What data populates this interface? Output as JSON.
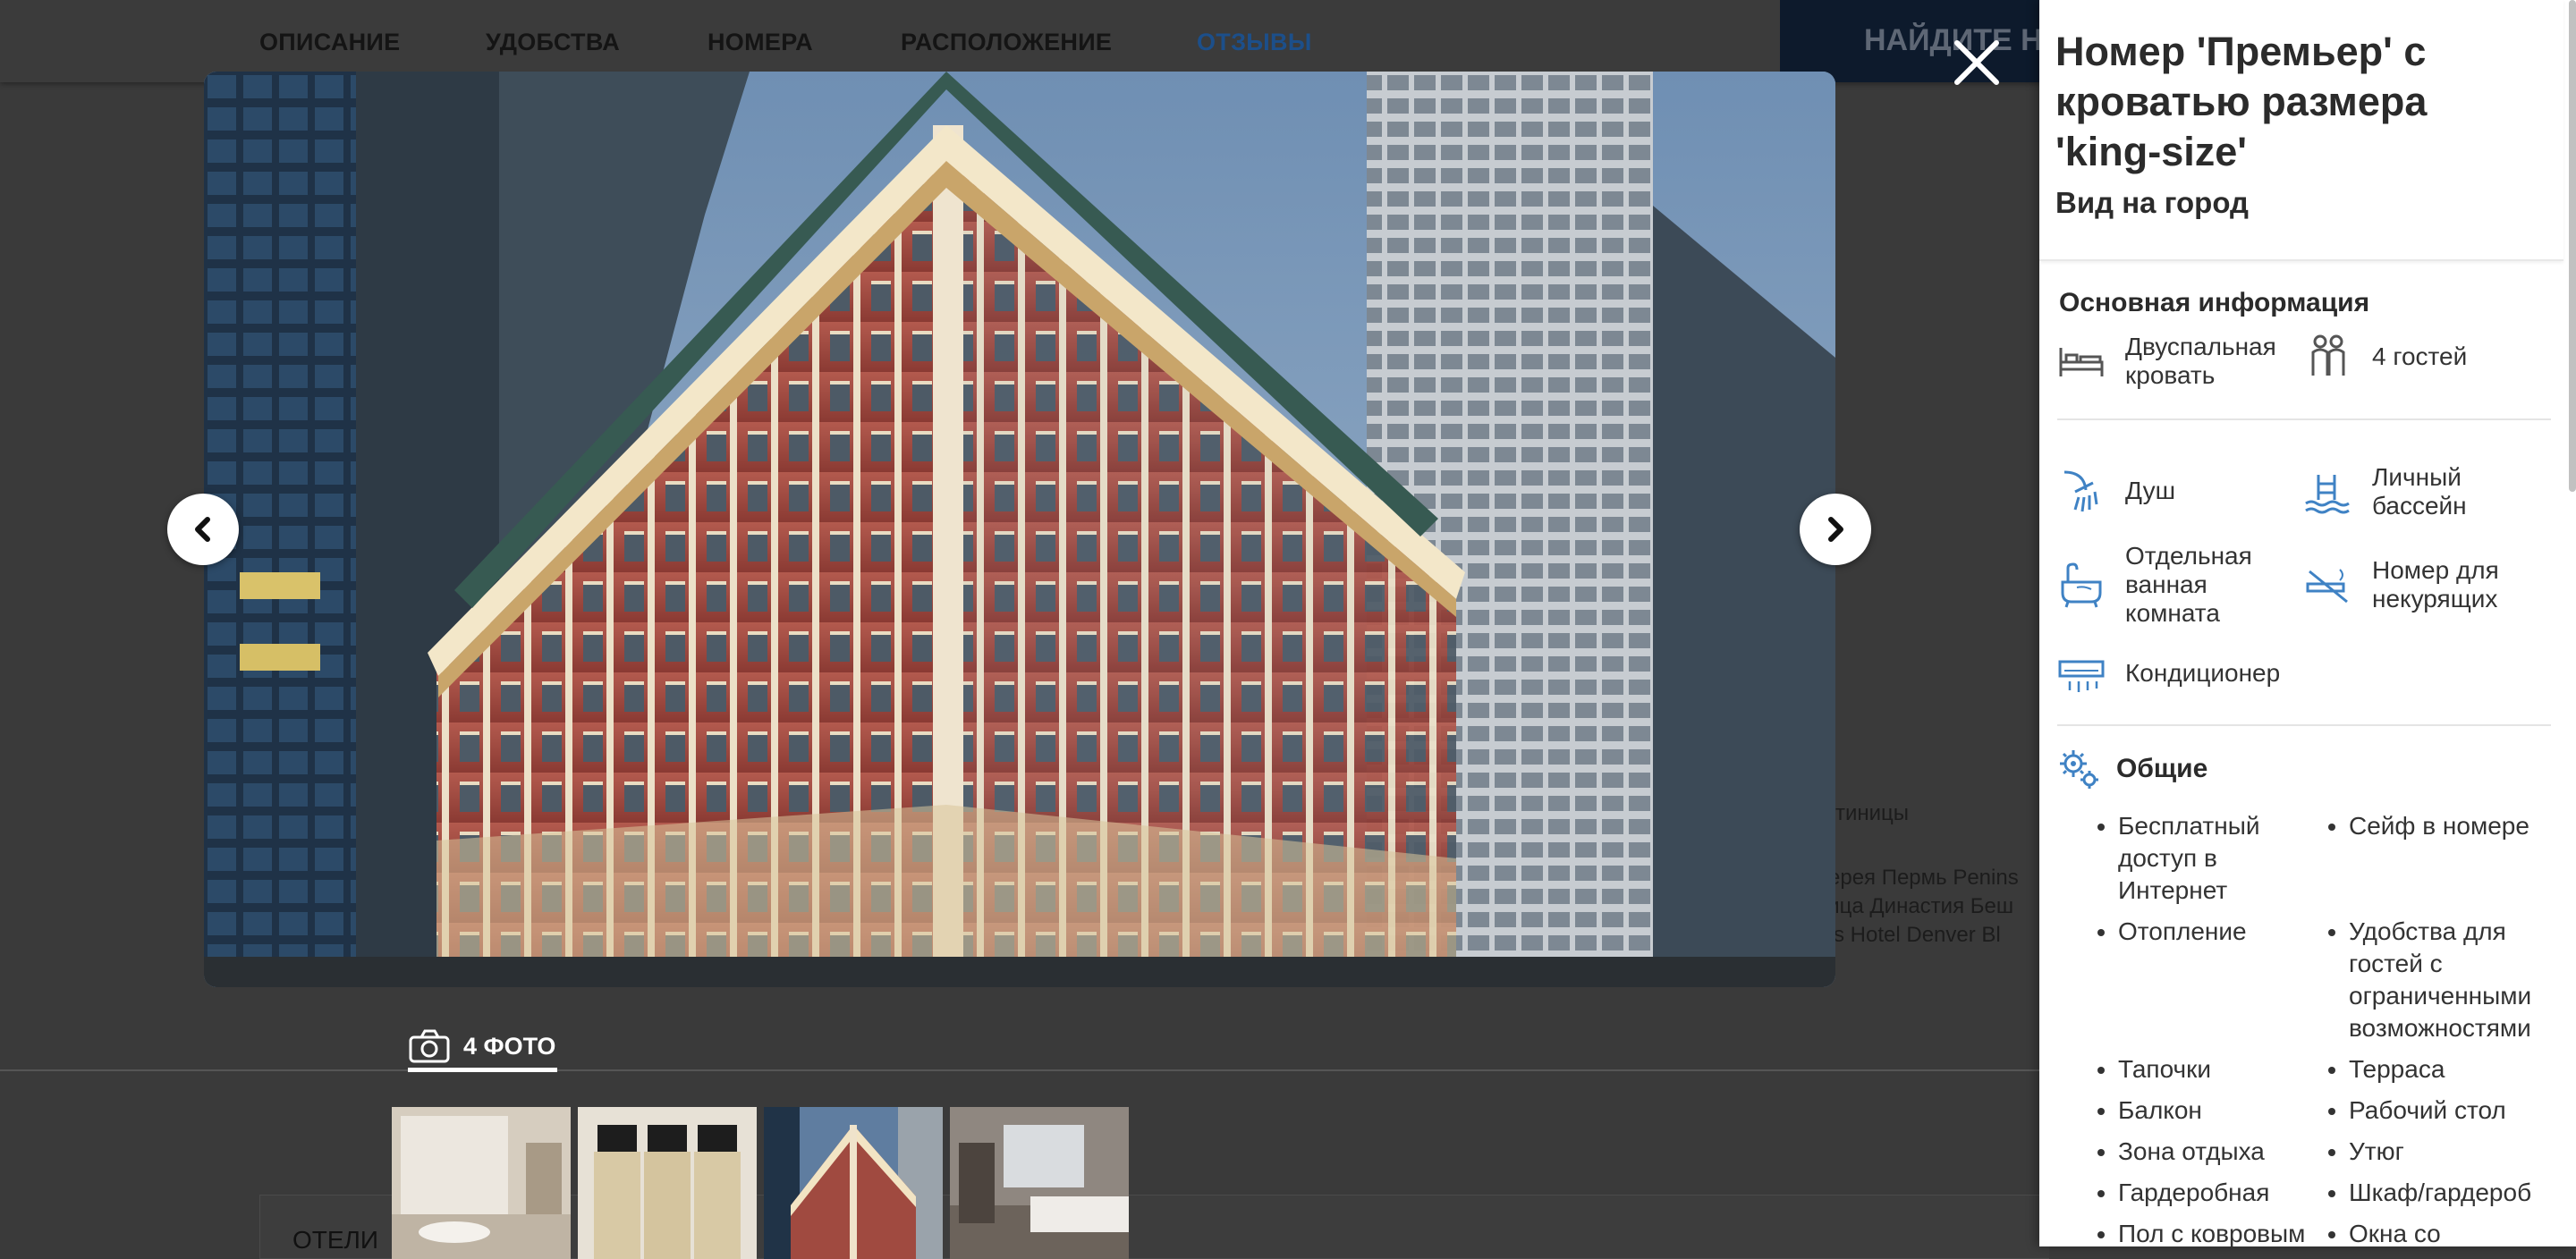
{
  "nav": {
    "items": [
      "ОПИСАНИЕ",
      "УДОБСТВА",
      "НОМЕРА",
      "РАСПОЛОЖЕНИЕ",
      "ОТЗЫВЫ"
    ],
    "active_index": 4,
    "cta_label": "НАЙДИТЕ Н"
  },
  "background": {
    "label_hotels_partial": "стиницы",
    "links_row1": "лерея Пермь  Penins",
    "links_row2": "ница Династия  Беш",
    "links_row3": "rtis Hotel Denver  Bl",
    "card_label": "ОТЕЛИ"
  },
  "gallery": {
    "photo_count_label": "4 ФОТО",
    "thumbnails": [
      "bathroom",
      "toiletries",
      "building-exterior",
      "bedroom"
    ],
    "selected_thumbnail": 2
  },
  "room": {
    "title": "Номер 'Премьер' с кроватью размера 'king-size'",
    "subtitle": "Вид на город"
  },
  "basic_info": {
    "heading": "Основная информация",
    "bed": "Двуспальная кровать",
    "guests": "4 гостей"
  },
  "amenities": {
    "shower": "Душ",
    "pool": "Личный бассейн",
    "bathroom": "Отдельная ванная комната",
    "non_smoking": "Номер для некурящих",
    "ac": "Кондиционер"
  },
  "general": {
    "heading": "Общие",
    "rows": [
      [
        "Бесплатный доступ в Интернет",
        "Сейф в номере"
      ],
      [
        "Отопление",
        "Удобства для гостей с ограниченными возможностями"
      ],
      [
        "Тапочки",
        "Терраса"
      ],
      [
        "Балкон",
        "Рабочий стол"
      ],
      [
        "Зона отдыха",
        "Утюг"
      ],
      [
        "Гардеробная",
        "Шкаф/гардероб"
      ],
      [
        "Пол с ковровым",
        "Окна со"
      ]
    ]
  },
  "icons": [
    "close-icon",
    "chevron-left-icon",
    "chevron-right-icon",
    "camera-icon",
    "bed-icon",
    "guests-icon",
    "shower-icon",
    "pool-icon",
    "bathtub-icon",
    "no-smoking-icon",
    "air-conditioner-icon",
    "gears-icon"
  ],
  "colors": {
    "accent": "#1c4f8a",
    "icon_blue": "#3f82c4",
    "overlay": "#3a3a3a"
  }
}
